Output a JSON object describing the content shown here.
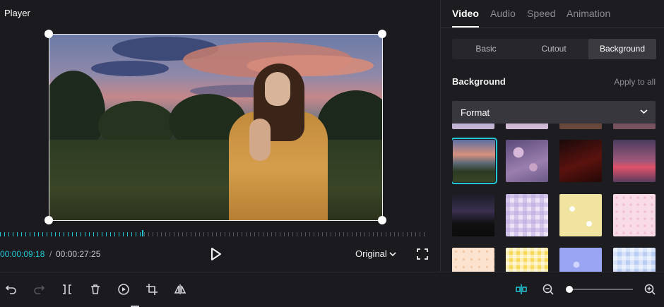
{
  "player": {
    "title": "Player",
    "time_current": "00:00:09:18",
    "time_separator": "/",
    "time_total": "00:00:27:25",
    "aspect_ratio": "Original",
    "progress_fraction": 0.333
  },
  "tabs": [
    {
      "label": "Video",
      "active": true
    },
    {
      "label": "Audio",
      "active": false
    },
    {
      "label": "Speed",
      "active": false
    },
    {
      "label": "Animation",
      "active": false
    }
  ],
  "subtabs": [
    {
      "label": "Basic",
      "active": false
    },
    {
      "label": "Cutout",
      "active": false
    },
    {
      "label": "Background",
      "active": true
    }
  ],
  "background_section": {
    "title": "Background",
    "apply_all": "Apply to all",
    "format_label": "Format"
  },
  "thumbnails": [
    {
      "name": "bg-thumb-1",
      "selected": false
    },
    {
      "name": "bg-thumb-2",
      "selected": false
    },
    {
      "name": "bg-thumb-3",
      "selected": false
    },
    {
      "name": "bg-thumb-4",
      "selected": false
    },
    {
      "name": "bg-thumb-sunset-field",
      "selected": true
    },
    {
      "name": "bg-thumb-flowers",
      "selected": false
    },
    {
      "name": "bg-thumb-dark-red",
      "selected": false
    },
    {
      "name": "bg-thumb-pink-room",
      "selected": false
    },
    {
      "name": "bg-thumb-phone-camera",
      "selected": false
    },
    {
      "name": "bg-thumb-bunny-check",
      "selected": false
    },
    {
      "name": "bg-thumb-daisy-yellow",
      "selected": false
    },
    {
      "name": "bg-thumb-pink-dots",
      "selected": false
    },
    {
      "name": "bg-thumb-peach-dots",
      "selected": false
    },
    {
      "name": "bg-thumb-yellow-check",
      "selected": false
    },
    {
      "name": "bg-thumb-blue-bubbles",
      "selected": false
    },
    {
      "name": "bg-thumb-blue-bear",
      "selected": false
    }
  ],
  "toolbar": {
    "icons": [
      "undo-icon",
      "redo-icon",
      "split-icon",
      "delete-icon",
      "replay-icon",
      "crop-icon",
      "mirror-icon",
      "snap-icon",
      "zoom-out-icon",
      "zoom-in-icon"
    ],
    "zoom_level_fraction": 0.0
  },
  "colors": {
    "accent": "#22c7d5",
    "panel": "#1d1d21",
    "background": "#1b1b1f"
  }
}
